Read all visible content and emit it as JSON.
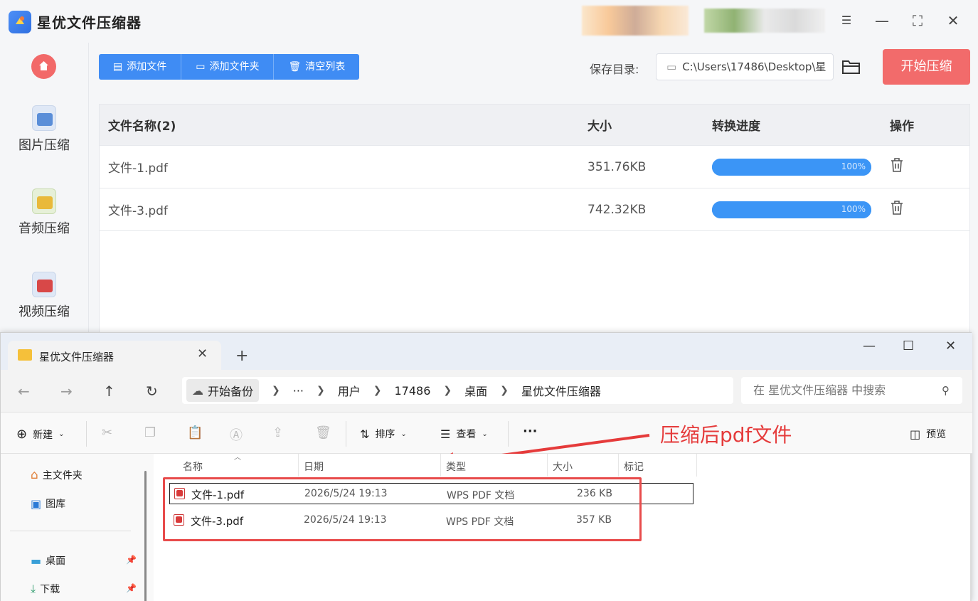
{
  "app": {
    "title": "星优文件压缩器",
    "sidebar": [
      {
        "label": "图片压缩",
        "icon": "image-compress-icon"
      },
      {
        "label": "音频压缩",
        "icon": "audio-compress-icon"
      },
      {
        "label": "视频压缩",
        "icon": "video-compress-icon"
      }
    ],
    "toolbar": {
      "add_file": "添加文件",
      "add_folder": "添加文件夹",
      "clear_list": "清空列表",
      "save_dir_label": "保存目录:",
      "save_dir_value": "C:\\Users\\17486\\Desktop\\星",
      "start_button": "开始压缩"
    },
    "table": {
      "headers": {
        "name": "文件名称(2)",
        "size": "大小",
        "progress": "转换进度",
        "ops": "操作"
      },
      "rows": [
        {
          "name": "文件-1.pdf",
          "size": "351.76KB",
          "progress": "100%",
          "progress_value": 1.0
        },
        {
          "name": "文件-3.pdf",
          "size": "742.32KB",
          "progress": "100%",
          "progress_value": 1.0
        }
      ]
    },
    "colors": {
      "accent": "#3f8cf4",
      "start": "#f26b6b",
      "progress": "#3b95f6"
    }
  },
  "explorer": {
    "tab_title": "星优文件压缩器",
    "breadcrumbs": [
      "开始备份",
      "···",
      "用户",
      "17486",
      "桌面",
      "星优文件压缩器"
    ],
    "search_placeholder": "在 星优文件压缩器 中搜索",
    "commands": {
      "new": "新建",
      "sort": "排序",
      "view": "查看",
      "more": "···",
      "preview": "预览"
    },
    "nav": [
      {
        "label": "主文件夹",
        "icon": "home-icon"
      },
      {
        "label": "图库",
        "icon": "gallery-icon"
      },
      {
        "label": "桌面",
        "icon": "desktop-icon",
        "pinned": true
      },
      {
        "label": "下载",
        "icon": "download-icon",
        "pinned": true
      }
    ],
    "columns": {
      "name": "名称",
      "date": "日期",
      "type": "类型",
      "size": "大小",
      "tag": "标记"
    },
    "files": [
      {
        "name": "文件-1.pdf",
        "date": "2026/5/24 19:13",
        "type": "WPS PDF 文档",
        "size": "236 KB"
      },
      {
        "name": "文件-3.pdf",
        "date": "2026/5/24 19:13",
        "type": "WPS PDF 文档",
        "size": "357 KB"
      }
    ],
    "annotation": "压缩后pdf文件"
  }
}
